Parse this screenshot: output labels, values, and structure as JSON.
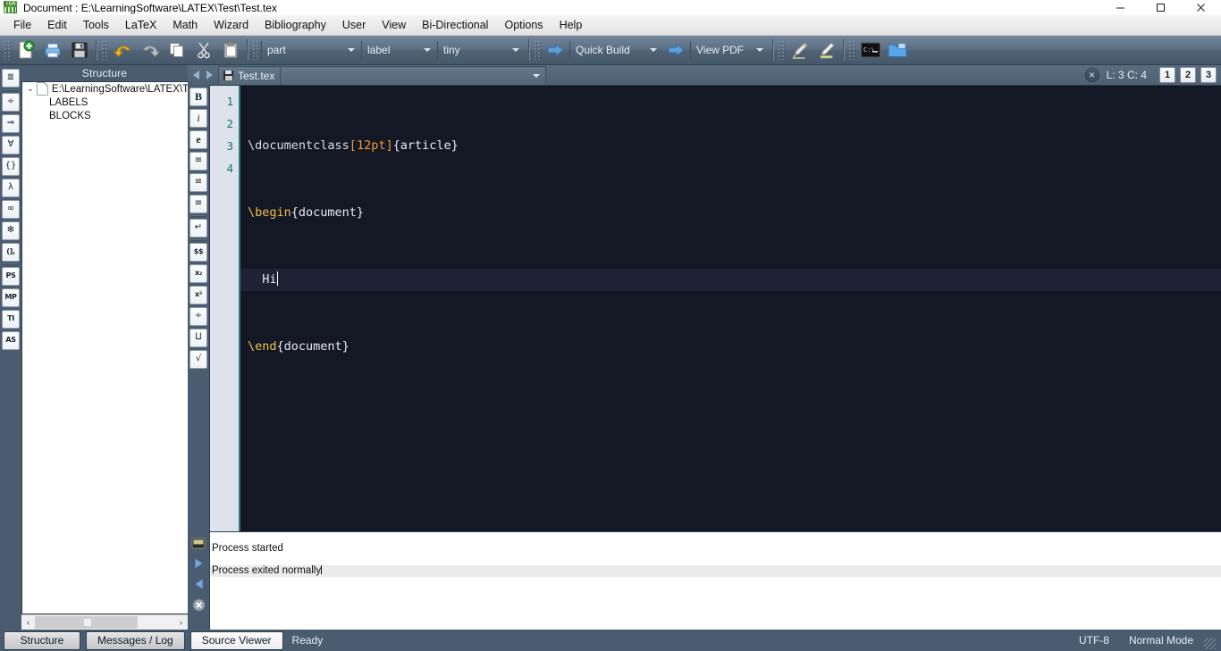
{
  "window": {
    "title": "Document : E:\\LearningSoftware\\LATEX\\Test\\Test.tex",
    "app_icon": "texstudio-logo-icon",
    "controls": {
      "minimize": "minimize-icon",
      "maximize": "maximize-icon",
      "close": "close-icon"
    }
  },
  "menubar": {
    "items": [
      {
        "label": "File"
      },
      {
        "label": "Edit"
      },
      {
        "label": "Tools"
      },
      {
        "label": "LaTeX"
      },
      {
        "label": "Math"
      },
      {
        "label": "Wizard"
      },
      {
        "label": "Bibliography"
      },
      {
        "label": "User"
      },
      {
        "label": "View"
      },
      {
        "label": "Bi-Directional"
      },
      {
        "label": "Options"
      },
      {
        "label": "Help"
      }
    ]
  },
  "toolbar": {
    "buttons": [
      {
        "name": "new-document-button",
        "icon": "new-document-icon"
      },
      {
        "name": "open-document-button",
        "icon": "open-folder-icon"
      },
      {
        "name": "save-document-button",
        "icon": "save-floppy-icon"
      },
      {
        "name": "undo-button",
        "icon": "undo-arrow-icon"
      },
      {
        "name": "redo-button",
        "icon": "redo-arrow-icon"
      },
      {
        "name": "copy-button",
        "icon": "copy-icon"
      },
      {
        "name": "cut-button",
        "icon": "scissors-icon"
      },
      {
        "name": "paste-button",
        "icon": "clipboard-icon"
      }
    ],
    "structure_level": "part",
    "reference_type": "label",
    "font_size": "tiny",
    "build_action": "Quick Build",
    "view_action": "View PDF",
    "extra_buttons": [
      {
        "name": "pencil-tool-button",
        "icon": "pencil-icon"
      },
      {
        "name": "highlight-tool-button",
        "icon": "highlighter-icon"
      },
      {
        "name": "console-button",
        "icon": "terminal-icon"
      },
      {
        "name": "open-folder-button",
        "icon": "folder-open-icon"
      }
    ]
  },
  "left_toolbar": {
    "buttons": [
      {
        "glyph": "≣",
        "name": "list-environment-icon"
      },
      {
        "glyph": "÷",
        "name": "division-icon"
      },
      {
        "glyph": "⇒",
        "name": "implies-arrow-icon"
      },
      {
        "glyph": "∀",
        "name": "forall-icon"
      },
      {
        "glyph": "{}",
        "name": "braces-icon"
      },
      {
        "glyph": "λ",
        "name": "lambda-icon"
      },
      {
        "glyph": "∞",
        "name": "infinity-icon"
      },
      {
        "glyph": "✻",
        "name": "asterisk-icon"
      },
      {
        "glyph": "(],",
        "name": "delimiters-icon"
      },
      {
        "glyph": "PS",
        "name": "postscript-icon"
      },
      {
        "glyph": "MP",
        "name": "metapost-icon"
      },
      {
        "glyph": "TI",
        "name": "tikz-icon"
      },
      {
        "glyph": "AS",
        "name": "asymptote-icon"
      }
    ]
  },
  "structure_panel": {
    "title": "Structure",
    "tree": [
      {
        "label": "E:\\LearningSoftware\\LATEX\\T",
        "icon": "document-icon",
        "chevron": "⌄",
        "level": 0
      },
      {
        "label": "LABELS",
        "level": 1
      },
      {
        "label": "BLOCKS",
        "level": 1
      }
    ],
    "scrollbar": {
      "left_arrow": "‹",
      "right_arrow": "›"
    }
  },
  "editor_toolbar": {
    "buttons": [
      {
        "glyph": "B",
        "name": "bold-icon"
      },
      {
        "glyph": "i",
        "name": "italic-icon"
      },
      {
        "glyph": "e",
        "name": "emphasis-icon"
      },
      {
        "glyph": "≡",
        "name": "align-left-icon"
      },
      {
        "glyph": "≡",
        "name": "align-center-icon"
      },
      {
        "glyph": "≡",
        "name": "align-right-icon"
      },
      {
        "glyph": "↵",
        "name": "newline-icon"
      },
      {
        "glyph": "$$",
        "name": "math-mode-icon"
      },
      {
        "glyph": "x₂",
        "name": "subscript-icon"
      },
      {
        "glyph": "x²",
        "name": "superscript-icon"
      },
      {
        "glyph": "÷",
        "name": "fraction-icon"
      },
      {
        "glyph": "⨿",
        "name": "dfraction-icon"
      },
      {
        "glyph": "√",
        "name": "square-root-icon"
      }
    ]
  },
  "tabbar": {
    "back_icon": "nav-back-icon",
    "forward_icon": "nav-forward-icon",
    "tab_label": "Test.tex",
    "tab_icon": "save-floppy-icon",
    "dropdown_icon": "chevron-down-icon",
    "close_icon": "close-icon",
    "cursor_position": "L: 3 C: 4",
    "view_buttons": [
      "1",
      "2",
      "3"
    ]
  },
  "editor": {
    "lines": [
      {
        "number": "1",
        "active": false,
        "tokens": [
          {
            "text": "\\documentclass",
            "type": "cmd"
          },
          {
            "text": "[",
            "type": "brk"
          },
          {
            "text": "12pt",
            "type": "brk"
          },
          {
            "text": "]",
            "type": "brk"
          },
          {
            "text": "{article}",
            "type": "brace"
          }
        ]
      },
      {
        "number": "2",
        "active": false,
        "tokens": [
          {
            "text": "\\begin",
            "type": "env"
          },
          {
            "text": "{document}",
            "type": "brace"
          }
        ]
      },
      {
        "number": "3",
        "active": true,
        "tokens": [
          {
            "text": "  Hi",
            "type": "brace"
          }
        ]
      },
      {
        "number": "4",
        "active": false,
        "tokens": [
          {
            "text": "\\end",
            "type": "env"
          },
          {
            "text": "{document}",
            "type": "brace"
          }
        ]
      }
    ]
  },
  "log_panel": {
    "buttons": [
      {
        "name": "view-log-button",
        "icon": "terminal-icon"
      },
      {
        "name": "next-error-button",
        "icon": "arrow-right-icon"
      },
      {
        "name": "previous-error-button",
        "icon": "arrow-left-icon"
      },
      {
        "name": "close-log-button",
        "icon": "close-icon"
      }
    ],
    "lines": [
      {
        "text": "Process started",
        "selected": false
      },
      {
        "text": "Process exited normally",
        "selected": true
      }
    ]
  },
  "bottom_bar": {
    "panel_buttons": [
      {
        "label": "Structure",
        "active": false
      },
      {
        "label": "Messages / Log",
        "active": false
      },
      {
        "label": "Source Viewer",
        "active": true
      }
    ],
    "status": "Ready",
    "encoding": "UTF-8",
    "mode": "Normal Mode"
  },
  "colors": {
    "chrome": "#4a5d70",
    "editor_background": "#141824",
    "gutter": "#dce3ec",
    "line_number": "#1c7078",
    "env_token": "#f2c14a",
    "bracket_token": "#f09a3a",
    "accent_blue": "#5a8fd0"
  }
}
